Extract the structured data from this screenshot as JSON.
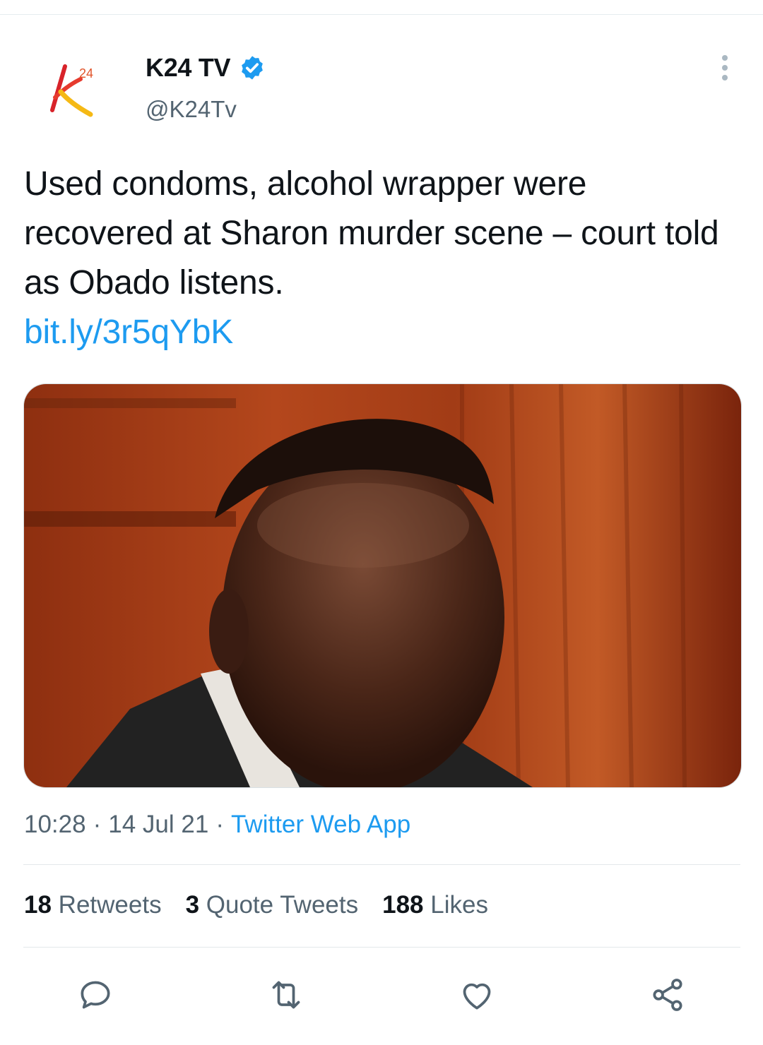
{
  "account": {
    "display_name": "K24 TV",
    "handle": "@K24Tv",
    "verified": true,
    "avatar_icon": "k24-logo-icon"
  },
  "tweet": {
    "text": "Used condoms, alcohol wrapper were recovered at Sharon murder scene – court told as Obado listens.",
    "link": "bit.ly/3r5qYbK",
    "media_alt_icon": "photo-man-in-courtroom"
  },
  "meta": {
    "time": "10:28",
    "date": "14 Jul 21",
    "source": "Twitter Web App",
    "separator": "·"
  },
  "stats": {
    "retweets_count": "18",
    "retweets_label": "Retweets",
    "quotes_count": "3",
    "quotes_label": "Quote Tweets",
    "likes_count": "188",
    "likes_label": "Likes"
  },
  "actions": [
    "reply-icon",
    "retweet-icon",
    "like-icon",
    "share-icon"
  ],
  "colors": {
    "link": "#1d9bf0",
    "secondary_text": "#536471",
    "primary_text": "#0f1419",
    "verified": "#1d9bf0"
  }
}
